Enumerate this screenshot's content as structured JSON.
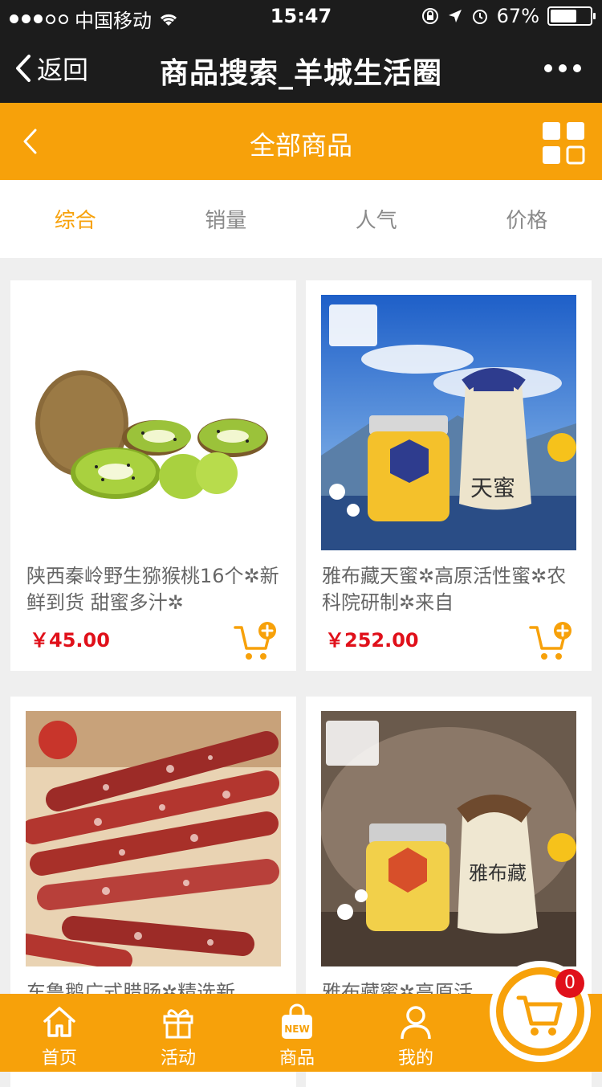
{
  "status_bar": {
    "carrier": "中国移动",
    "time": "15:47",
    "battery": "67%"
  },
  "nav": {
    "back_label": "返回",
    "title": "商品搜索_羊城生活圈"
  },
  "category_bar": {
    "title": "全部商品"
  },
  "sort_tabs": [
    {
      "label": "综合",
      "active": true
    },
    {
      "label": "销量",
      "active": false
    },
    {
      "label": "人气",
      "active": false
    },
    {
      "label": "价格",
      "active": false
    }
  ],
  "products": [
    {
      "name": "陕西秦岭野生猕猴桃16个✲新鲜到货 甜蜜多汁✲",
      "price": "￥45.00",
      "image": "kiwi-fruit"
    },
    {
      "name": "雅布藏天蜜✲高原活性蜜✲农科院研制✲来自",
      "price": "￥252.00",
      "image": "honey-jar-blue-sky"
    },
    {
      "name": "东鲁鹅广式腊肠✲精选新",
      "price": "",
      "image": "cantonese-sausage"
    },
    {
      "name": "雅布藏蜜✲高原活",
      "price": "",
      "image": "honey-jar-dark"
    }
  ],
  "tab_bar": {
    "items": [
      {
        "label": "首页",
        "icon": "home-icon"
      },
      {
        "label": "活动",
        "icon": "gift-icon"
      },
      {
        "label": "商品",
        "icon": "shopping-bag-new-icon"
      },
      {
        "label": "我的",
        "icon": "user-icon"
      }
    ],
    "cart_count": "0"
  },
  "colors": {
    "accent": "#f7a10a",
    "price": "#e0101a",
    "nav_bg": "#1c1c1c"
  }
}
